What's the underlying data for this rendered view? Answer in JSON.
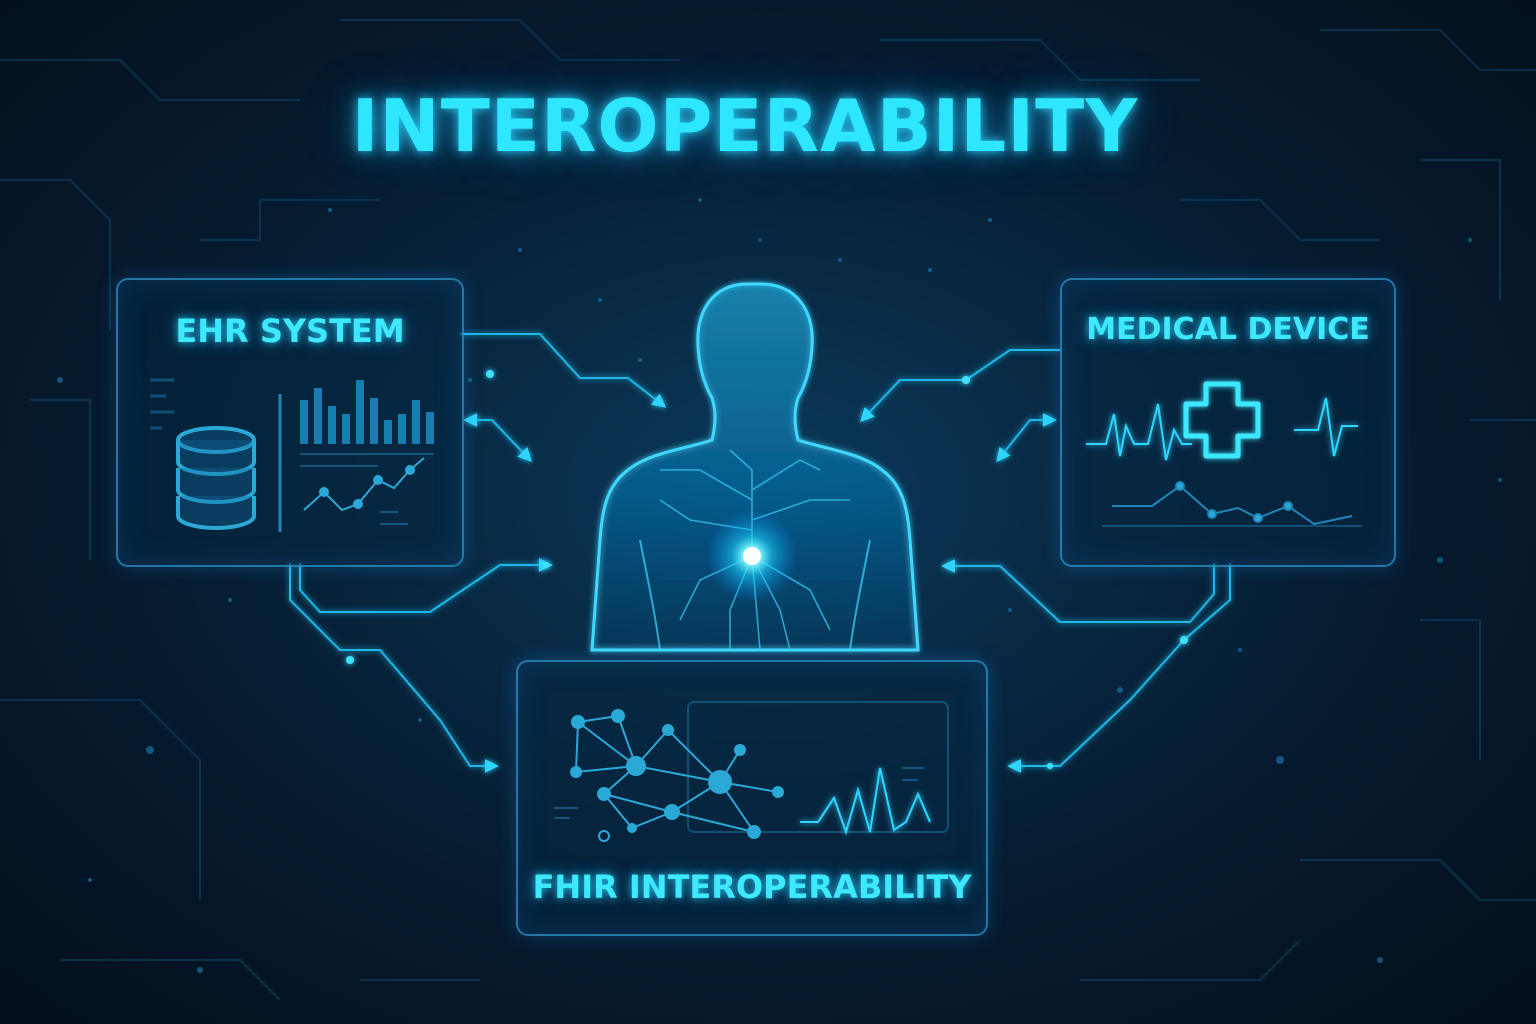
{
  "title": "INTEROPERABILITY",
  "panels": {
    "ehr": {
      "label": "EHR SYSTEM",
      "icons": [
        "database-icon",
        "bar-chart-icon",
        "line-chart-icon"
      ]
    },
    "device": {
      "label": "MEDICAL DEVICE",
      "icons": [
        "medical-cross-icon",
        "ecg-waveform-icon",
        "line-chart-icon"
      ]
    },
    "fhir": {
      "label": "FHIR INTEROPERABILITY",
      "icons": [
        "network-graph-icon",
        "waveform-icon"
      ]
    }
  },
  "center": {
    "icon": "human-figure-icon",
    "core": "glowing-core-icon"
  },
  "colors": {
    "accent": "#2fe6ff",
    "line": "#1fb8e8",
    "background": "#061b2f"
  }
}
